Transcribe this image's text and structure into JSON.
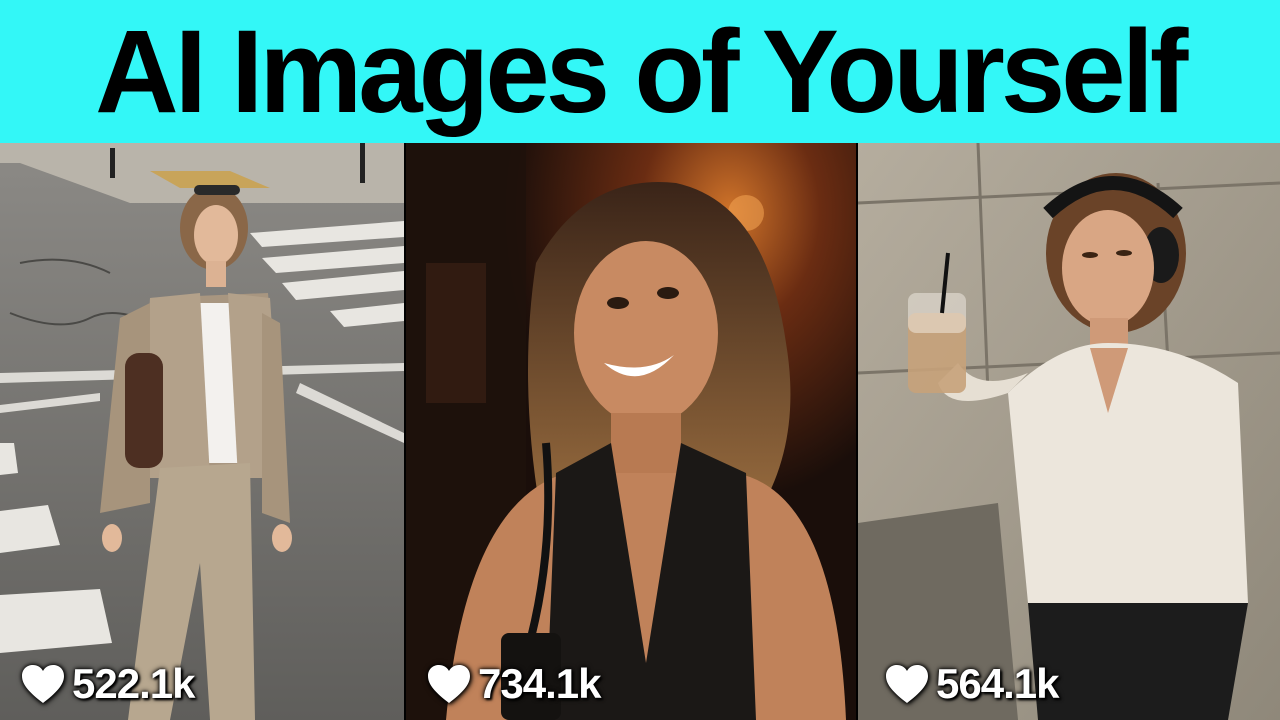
{
  "header": {
    "title": "AI Images of Yourself",
    "background": "#33f7f7"
  },
  "photos": [
    {
      "scene": "woman walking across a city crosswalk in a beige jacket and trousers",
      "likes": "522.1k"
    },
    {
      "scene": "smiling woman in a black halter top in a dim restaurant",
      "likes": "734.1k"
    },
    {
      "scene": "woman with headphones holding an iced coffee by a stone wall",
      "likes": "564.1k"
    }
  ],
  "icons": {
    "like": "heart-icon"
  }
}
